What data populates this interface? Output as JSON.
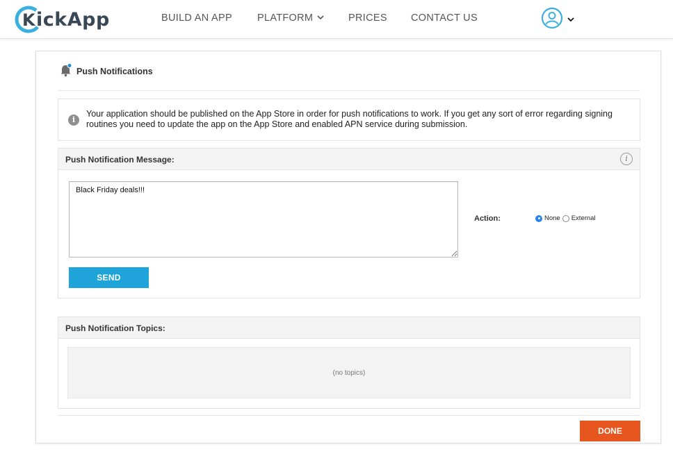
{
  "brand": {
    "name": "ickApp",
    "logo_letter": "K"
  },
  "nav": {
    "items": [
      {
        "label": "BUILD AN APP"
      },
      {
        "label": "PLATFORM"
      },
      {
        "label": "PRICES"
      },
      {
        "label": "CONTACT US"
      }
    ]
  },
  "page": {
    "title": "Push Notifications"
  },
  "notice": {
    "text": "Your application should be published on the App Store in order for push notifications to work. If you get any sort of error regarding signing routines you need to update the app on the App Store and enabled APN service during submission."
  },
  "message_panel": {
    "heading": "Push Notification Message:",
    "message_value": "Black Friday deals!!!",
    "send_label": "SEND",
    "action_label": "Action:",
    "action_options": [
      {
        "label": "None",
        "selected": true
      },
      {
        "label": "External",
        "selected": false
      }
    ]
  },
  "topics_panel": {
    "heading": "Push Notification Topics:",
    "empty_text": "(no topics)"
  },
  "footer": {
    "done_label": "DONE"
  },
  "colors": {
    "accent_blue": "#1fa4d9",
    "done_orange": "#e8561f",
    "logo_blue": "#3bb0de",
    "logo_dark": "#3a4756"
  }
}
